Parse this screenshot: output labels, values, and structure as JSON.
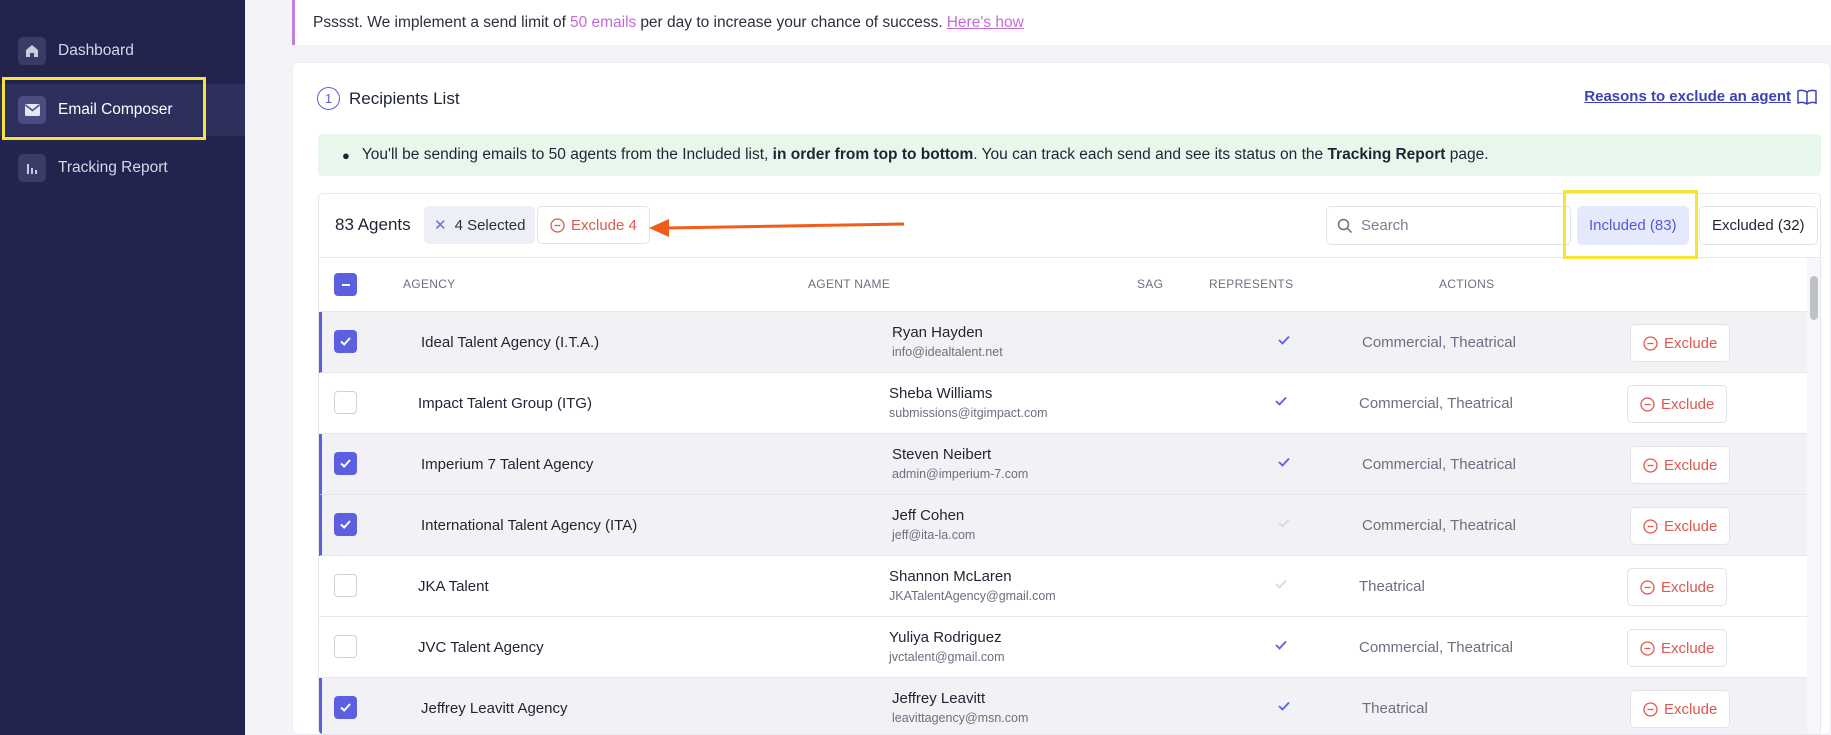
{
  "sidebar": {
    "items": [
      {
        "label": "Dashboard",
        "icon": "home-icon",
        "active": false
      },
      {
        "label": "Email Composer",
        "icon": "mail-icon",
        "active": true
      },
      {
        "label": "Tracking Report",
        "icon": "bar-chart-icon",
        "active": false
      }
    ]
  },
  "notice": {
    "prefix": "Psssst. We implement a send limit of",
    "limit": "50 emails",
    "suffix": "per day to increase your chance of success.",
    "link": "Here's how"
  },
  "recipients": {
    "step": "1",
    "title": "Recipients List",
    "reasons_link": "Reasons to exclude an agent",
    "info_part1": "You'll be sending emails to 50 agents from the Included list, ",
    "info_bold1": "in order from top to bottom",
    "info_part2": ". You can track each send and see its status on the ",
    "info_bold2": "Tracking Report",
    "info_part3": " page."
  },
  "toolbar": {
    "agents_count": "83 Agents",
    "selected": "4 Selected",
    "exclude_selected": "Exclude 4",
    "search_placeholder": "Search",
    "tab_included": "Included (83)",
    "tab_excluded": "Excluded (32)"
  },
  "table": {
    "headers": [
      "AGENCY",
      "AGENT NAME",
      "SAG",
      "REPRESENTS",
      "ACTIONS"
    ],
    "action_label": "Exclude",
    "rows": [
      {
        "agency": "Ideal Talent Agency (I.T.A.)",
        "name": "Ryan Hayden",
        "email": "info@idealtalent.net",
        "sag": true,
        "represents": "Commercial, Theatrical",
        "selected": true
      },
      {
        "agency": "Impact Talent Group (ITG)",
        "name": "Sheba Williams",
        "email": "submissions@itgimpact.com",
        "sag": true,
        "represents": "Commercial, Theatrical",
        "selected": false
      },
      {
        "agency": "Imperium 7 Talent Agency",
        "name": "Steven Neibert",
        "email": "admin@imperium-7.com",
        "sag": true,
        "represents": "Commercial, Theatrical",
        "selected": true
      },
      {
        "agency": "International Talent Agency (ITA)",
        "name": "Jeff Cohen",
        "email": "jeff@ita-la.com",
        "sag": false,
        "represents": "Commercial, Theatrical",
        "selected": true
      },
      {
        "agency": "JKA Talent",
        "name": "Shannon McLaren",
        "email": "JKATalentAgency@gmail.com",
        "sag": false,
        "represents": "Theatrical",
        "selected": false
      },
      {
        "agency": "JVC Talent Agency",
        "name": "Yuliya Rodriguez",
        "email": "jvctalent@gmail.com",
        "sag": true,
        "represents": "Commercial, Theatrical",
        "selected": false
      },
      {
        "agency": "Jeffrey Leavitt Agency",
        "name": "Jeffrey Leavitt",
        "email": "leavittagency@msn.com",
        "sag": true,
        "represents": "Theatrical",
        "selected": true
      }
    ]
  },
  "colors": {
    "sidebar_bg": "#23244e",
    "accent": "#5b5fe0",
    "exclude_red": "#e0584f",
    "highlight_yellow": "#f7e33a",
    "annotation_arrow": "#f25c1a",
    "info_bg": "#e7f7ec"
  }
}
